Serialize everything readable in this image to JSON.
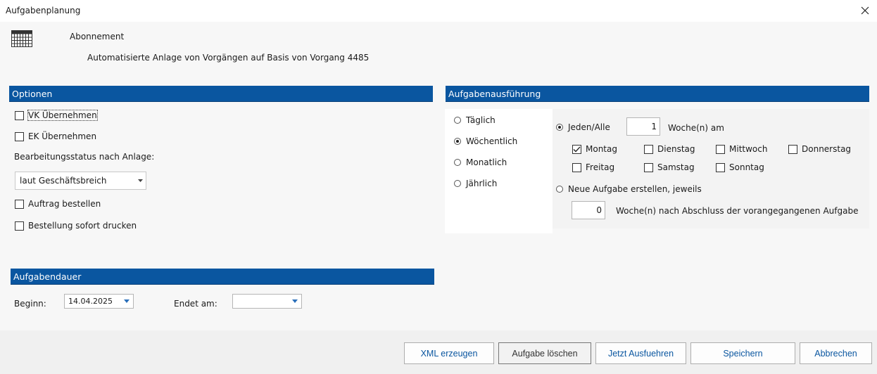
{
  "window": {
    "title": "Aufgabenplanung"
  },
  "header": {
    "title": "Abonnement",
    "subtitle": "Automatisierte Anlage von Vorgängen auf Basis von Vorgang 4485"
  },
  "optionen": {
    "heading": "Optionen",
    "vk": {
      "label": "VK Übernehmen",
      "checked": false
    },
    "ek": {
      "label": "EK Übernehmen",
      "checked": false
    },
    "status_label": "Bearbeitungsstatus nach Anlage:",
    "status_value": "laut Geschäftsbreich",
    "auftrag": {
      "label": "Auftrag bestellen",
      "checked": false
    },
    "drucken": {
      "label": "Bestellung sofort drucken",
      "checked": false
    }
  },
  "dauer": {
    "heading": "Aufgabendauer",
    "beginn_label": "Beginn:",
    "beginn_value": "14.04.2025",
    "ende_label": "Endet am:",
    "ende_value": ""
  },
  "ausfuehrung": {
    "heading": "Aufgabenausführung",
    "intervals": [
      {
        "label": "Täglich",
        "selected": false
      },
      {
        "label": "Wöchentlich",
        "selected": true
      },
      {
        "label": "Monatlich",
        "selected": false
      },
      {
        "label": "Jährlich",
        "selected": false
      }
    ],
    "jeden_label": "Jeden/Alle",
    "jeden_selected": true,
    "jeden_value": "1",
    "wochen_am_label": "Woche(n) am",
    "days": [
      {
        "label": "Montag",
        "checked": true
      },
      {
        "label": "Dienstag",
        "checked": false
      },
      {
        "label": "Mittwoch",
        "checked": false
      },
      {
        "label": "Donnerstag",
        "checked": false
      },
      {
        "label": "Freitag",
        "checked": false
      },
      {
        "label": "Samstag",
        "checked": false
      },
      {
        "label": "Sonntag",
        "checked": false
      }
    ],
    "neue_label": "Neue Aufgabe erstellen, jeweils",
    "neue_selected": false,
    "neue_value": "0",
    "neue_suffix": "Woche(n) nach Abschluss der vorangegangenen Aufgabe"
  },
  "buttons": {
    "xml": "XML erzeugen",
    "loeschen": "Aufgabe löschen",
    "ausfuehren": "Jetzt Ausfuehren",
    "speichern": "Speichern",
    "abbrechen": "Abbrechen"
  },
  "colors": {
    "section_bar": "#0a56a0",
    "button_text": "#0a56a0"
  }
}
